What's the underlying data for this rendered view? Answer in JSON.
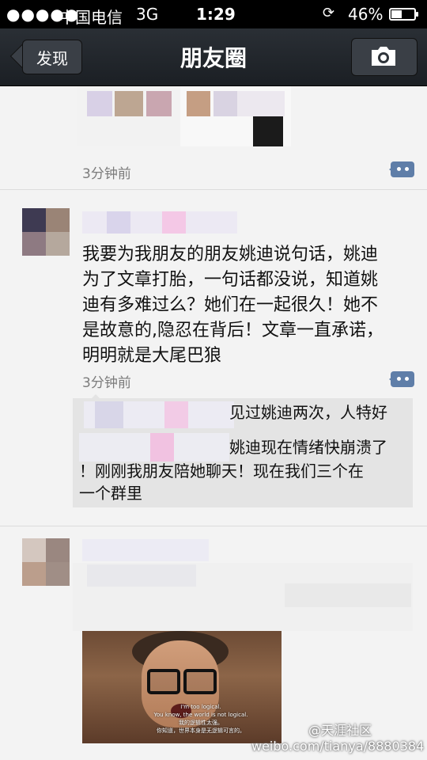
{
  "status_bar": {
    "signal_dots": "●●●●●",
    "carrier": "中国电信",
    "network": "3G",
    "time": "1:29",
    "rotation_lock_icon": "rotation-lock-icon",
    "battery_percent": "46%",
    "battery_level": 0.46
  },
  "nav": {
    "back_label": "发现",
    "title": "朋友圈",
    "camera_icon": "camera-icon"
  },
  "posts": [
    {
      "time": "3分钟前"
    },
    {
      "text_lines": [
        "我要为我朋友的朋友姚迪说句话，姚迪",
        "为了文章打胎，一句话都没说，知道姚",
        "迪有多难过么？她们在一起很久！她不",
        "是故意的,隐忍在背后！文章一直承诺，",
        "明明就是大尾巴狼"
      ],
      "time": "3分钟前",
      "comments": [
        "见过姚迪两次，人特好",
        "姚迪现在情绪快崩溃了",
        "！刚刚我朋友陪她聊天！现在我们三个在",
        "一个群里"
      ]
    },
    {
      "image_subtitles": [
        "I'm too logical.",
        "You know, the world is not logical.",
        "我的逻辑性太强。",
        "你知道，世界本身是无逻辑可言的。"
      ]
    }
  ],
  "watermark": {
    "line1": "@天涯社区",
    "line2": "weibo.com/tianya/8880384"
  },
  "colors": {
    "status_bg": "#000000",
    "nav_bg": "#1f2328",
    "comment_bg": "#e4e4e4",
    "accent_blue": "#5f7ea8"
  }
}
